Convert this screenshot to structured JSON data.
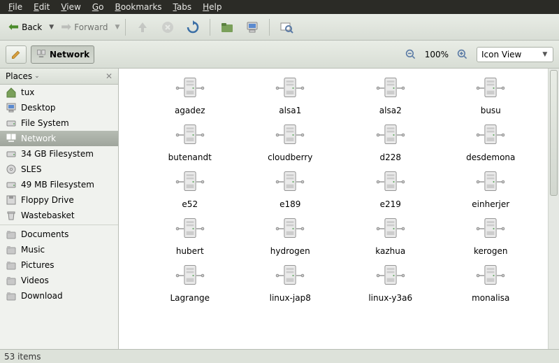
{
  "menu": [
    "File",
    "Edit",
    "View",
    "Go",
    "Bookmarks",
    "Tabs",
    "Help"
  ],
  "toolbar": {
    "back": "Back",
    "forward": "Forward"
  },
  "location": {
    "label": "Network"
  },
  "zoom": {
    "percent": "100%"
  },
  "view": {
    "mode": "Icon View"
  },
  "sidebar": {
    "title": "Places",
    "items": [
      {
        "label": "tux",
        "icon": "home"
      },
      {
        "label": "Desktop",
        "icon": "desktop"
      },
      {
        "label": "File System",
        "icon": "drive"
      },
      {
        "label": "Network",
        "icon": "network",
        "selected": true
      },
      {
        "label": "34 GB Filesystem",
        "icon": "drive"
      },
      {
        "label": "SLES",
        "icon": "disc"
      },
      {
        "label": "49 MB Filesystem",
        "icon": "drive"
      },
      {
        "label": "Floppy Drive",
        "icon": "floppy"
      },
      {
        "label": "Wastebasket",
        "icon": "trash"
      },
      {
        "sep": true
      },
      {
        "label": "Documents",
        "icon": "folder"
      },
      {
        "label": "Music",
        "icon": "folder"
      },
      {
        "label": "Pictures",
        "icon": "folder"
      },
      {
        "label": "Videos",
        "icon": "folder"
      },
      {
        "label": "Download",
        "icon": "folder"
      }
    ]
  },
  "items": [
    "agadez",
    "alsa1",
    "alsa2",
    "busu",
    "butenandt",
    "cloudberry",
    "d228",
    "desdemona",
    "e52",
    "e189",
    "e219",
    "einherjer",
    "hubert",
    "hydrogen",
    "kazhua",
    "kerogen",
    "Lagrange",
    "linux-jap8",
    "linux-y3a6",
    "monalisa"
  ],
  "status": {
    "text": "53 items"
  }
}
